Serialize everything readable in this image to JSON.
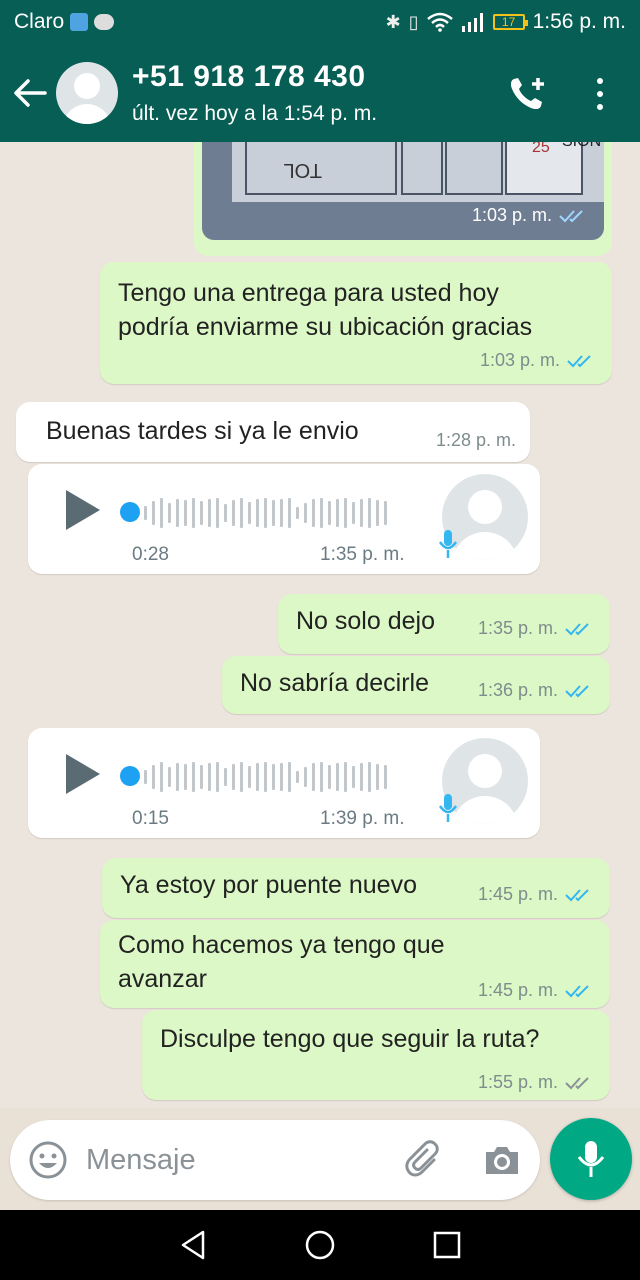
{
  "status_bar": {
    "carrier": "Claro",
    "battery": "17",
    "time": "1:56 p. m."
  },
  "header": {
    "contact_name": "+51 918 178 430",
    "last_seen": "últ. vez hoy a la 1:54 p. m."
  },
  "messages": [
    {
      "type": "image",
      "direction": "out",
      "time": "1:03 p. m.",
      "status": "read"
    },
    {
      "type": "text",
      "direction": "out",
      "lines": [
        "Tengo una entrega para usted hoy",
        "podría enviarme su ubicación gracias"
      ],
      "time": "1:03 p. m.",
      "status": "read"
    },
    {
      "type": "text",
      "direction": "in",
      "text": "Buenas tardes si ya le envio",
      "time": "1:28 p. m."
    },
    {
      "type": "voice",
      "direction": "in",
      "duration": "0:28",
      "time": "1:35 p. m."
    },
    {
      "type": "text",
      "direction": "out",
      "text": "No solo dejo",
      "time": "1:35 p. m.",
      "status": "read"
    },
    {
      "type": "text",
      "direction": "out",
      "text": "No sabría decirle",
      "time": "1:36 p. m.",
      "status": "read"
    },
    {
      "type": "voice",
      "direction": "in",
      "duration": "0:15",
      "time": "1:39 p. m."
    },
    {
      "type": "text",
      "direction": "out",
      "text": "Ya estoy por puente nuevo",
      "time": "1:45 p. m.",
      "status": "read"
    },
    {
      "type": "text",
      "direction": "out",
      "lines": [
        "Como hacemos ya tengo que",
        "avanzar"
      ],
      "time": "1:45 p. m.",
      "status": "read"
    },
    {
      "type": "text",
      "direction": "out",
      "text": "Disculpe tengo que seguir la ruta?",
      "time": "1:55 p. m.",
      "status": "delivered"
    }
  ],
  "input": {
    "placeholder": "Mensaje"
  },
  "icons": [
    "back-arrow-icon",
    "avatar-icon",
    "add-call-icon",
    "more-vert-icon",
    "emoji-icon",
    "attach-icon",
    "camera-icon",
    "mic-icon",
    "nav-back-icon",
    "nav-home-icon",
    "nav-recents-icon"
  ],
  "colors": {
    "header": "#075e54",
    "outgoing_bubble": "#dcf8c6",
    "incoming_bubble": "#ffffff",
    "read_ticks": "#34b7f1",
    "mic_button": "#00a884"
  }
}
